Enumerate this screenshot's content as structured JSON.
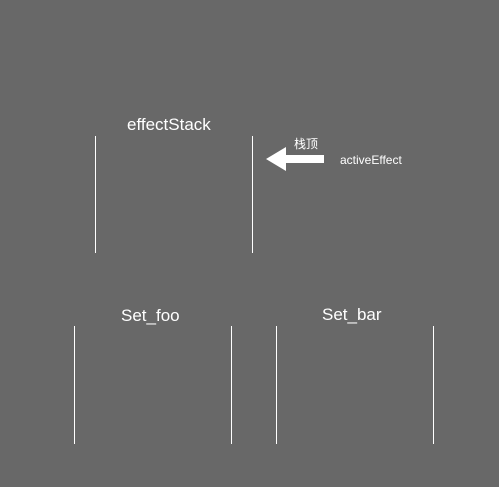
{
  "effect_stack": {
    "title": "effectStack",
    "pointer": {
      "label_top": "栈顶",
      "label_effect": "activeEffect"
    }
  },
  "set_foo": {
    "title": "Set_foo"
  },
  "set_bar": {
    "title": "Set_bar"
  },
  "colors": {
    "background": "#686868",
    "stroke": "#ffffff",
    "text": "#ffffff"
  },
  "icons": {
    "pointer": "arrow-left-icon"
  }
}
